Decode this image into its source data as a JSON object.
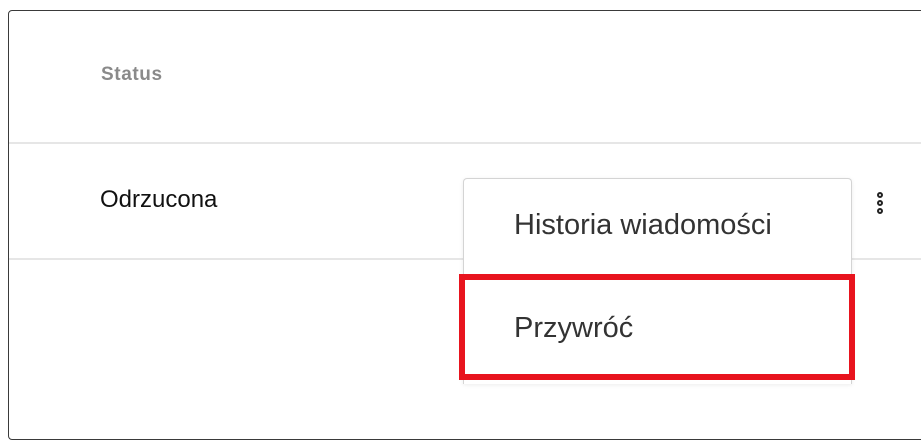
{
  "table": {
    "column_header": "Status",
    "row": {
      "status": "Odrzucona"
    }
  },
  "row_menu": {
    "icon": "more-vertical-icon",
    "items": [
      {
        "label": "Historia wiadomości"
      },
      {
        "label": "Przywróć",
        "highlighted": true
      }
    ]
  },
  "colors": {
    "highlight": "#e8141e",
    "header_text": "#8a8a8a",
    "divider": "#e6e6e6"
  }
}
